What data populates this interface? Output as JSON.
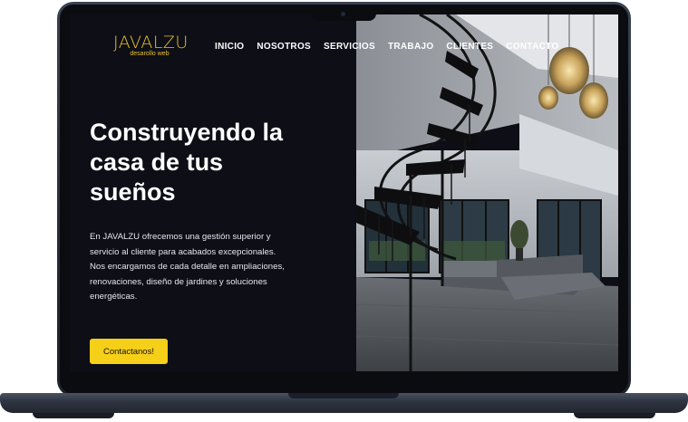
{
  "brand": {
    "name": "JAVALZU",
    "tagline": "desarollo web",
    "accent": "#f6cf19"
  },
  "nav": {
    "items": [
      "INICIO",
      "NOSOTROS",
      "SERVICIOS",
      "TRABAJO",
      "CLIENTES",
      "CONTACTO"
    ]
  },
  "hero": {
    "title": "Construyendo la casa de tus sueños",
    "text": "En JAVALZU ofrecemos una gestión superior y servicio al cliente para acabados excepcionales. Nos encargamos de cada detalle en ampliaciones, renovaciones, diseño de jardines y soluciones energéticas.",
    "button": "Contactanos!"
  },
  "colors": {
    "background": "#0d0e16",
    "text": "#ffffff",
    "frame": "#262b36"
  }
}
